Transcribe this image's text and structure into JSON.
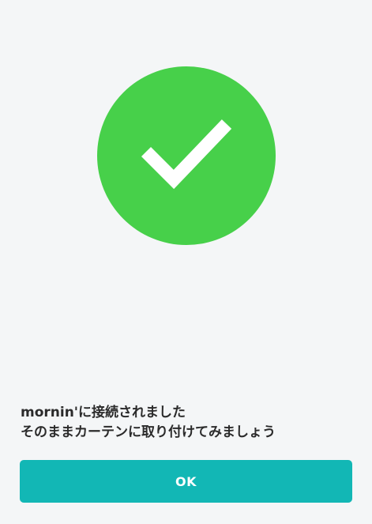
{
  "status_icon": {
    "name": "checkmark-icon",
    "background_color": "#47d04a",
    "check_color": "#ffffff"
  },
  "message": {
    "line1": "mornin'に接続されました",
    "line2": "そのままカーテンに取り付けてみましょう"
  },
  "actions": {
    "ok_label": "OK",
    "ok_color": "#12b7b5"
  }
}
